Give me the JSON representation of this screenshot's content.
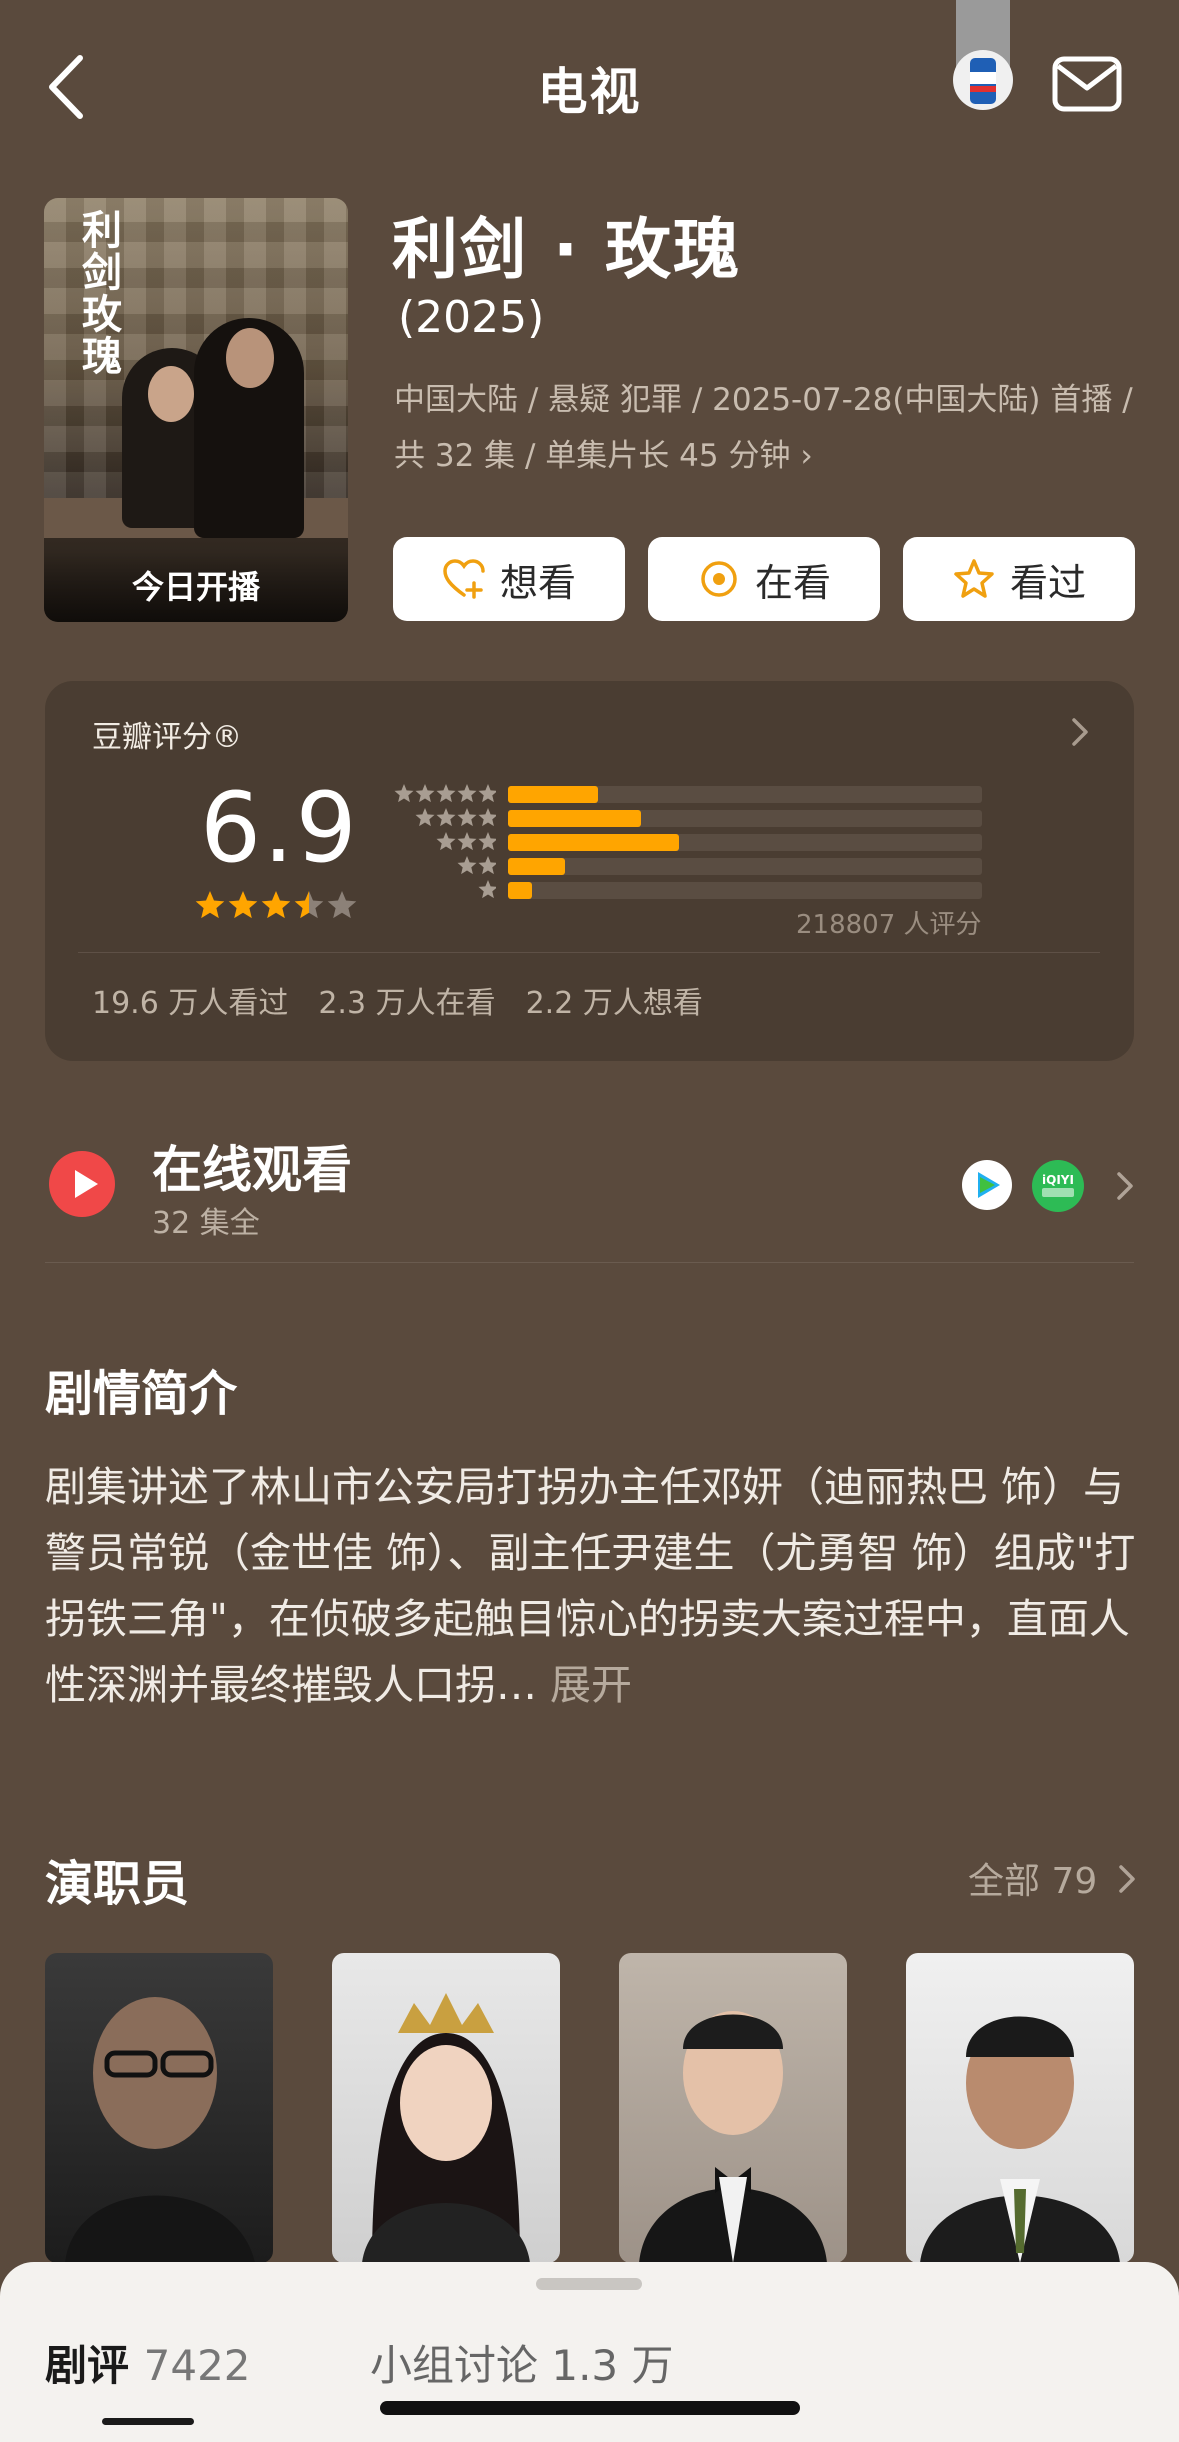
{
  "header": {
    "title": "电视"
  },
  "show": {
    "title": "利剑 · 玫瑰",
    "year": "(2025)",
    "meta": "中国大陆 / 悬疑 犯罪 / 2025-07-28(中国大陆) 首播 / 共 32 集 / 单集片长 45 分钟",
    "poster_title": "利剑玫瑰",
    "poster_label": "今日开播"
  },
  "actions": {
    "want": "想看",
    "watching": "在看",
    "watched": "看过"
  },
  "rating": {
    "label": "豆瓣评分®",
    "score": "6.9",
    "stars": 3.5,
    "distribution": [
      0.19,
      0.28,
      0.36,
      0.12,
      0.05
    ],
    "count_text": "218807 人评分",
    "stats": [
      "19.6 万人看过",
      "2.3 万人在看",
      "2.2 万人想看"
    ]
  },
  "watch": {
    "title": "在线观看",
    "subtitle": "32 集全"
  },
  "synopsis": {
    "title": "剧情简介",
    "body": "剧集讲述了林山市公安局打拐办主任邓妍（迪丽热巴 饰）与警员常锐（金世佳 饰）、副主任尹建生（尤勇智 饰）组成\"打拐铁三角\"，在侦破多起触目惊心的拐卖大案过程中，直面人性深渊并最终摧毁人口拐…",
    "more": "展开"
  },
  "cast": {
    "title": "演职员",
    "all_label": "全部 79"
  },
  "sheet": {
    "tab_reviews": "剧评",
    "tab_reviews_count": "7422",
    "tab_groups": "小组讨论 1.3 万"
  },
  "colors": {
    "background": "#5a4a3d",
    "accent": "#ffa500",
    "card": "#4a3d32"
  }
}
